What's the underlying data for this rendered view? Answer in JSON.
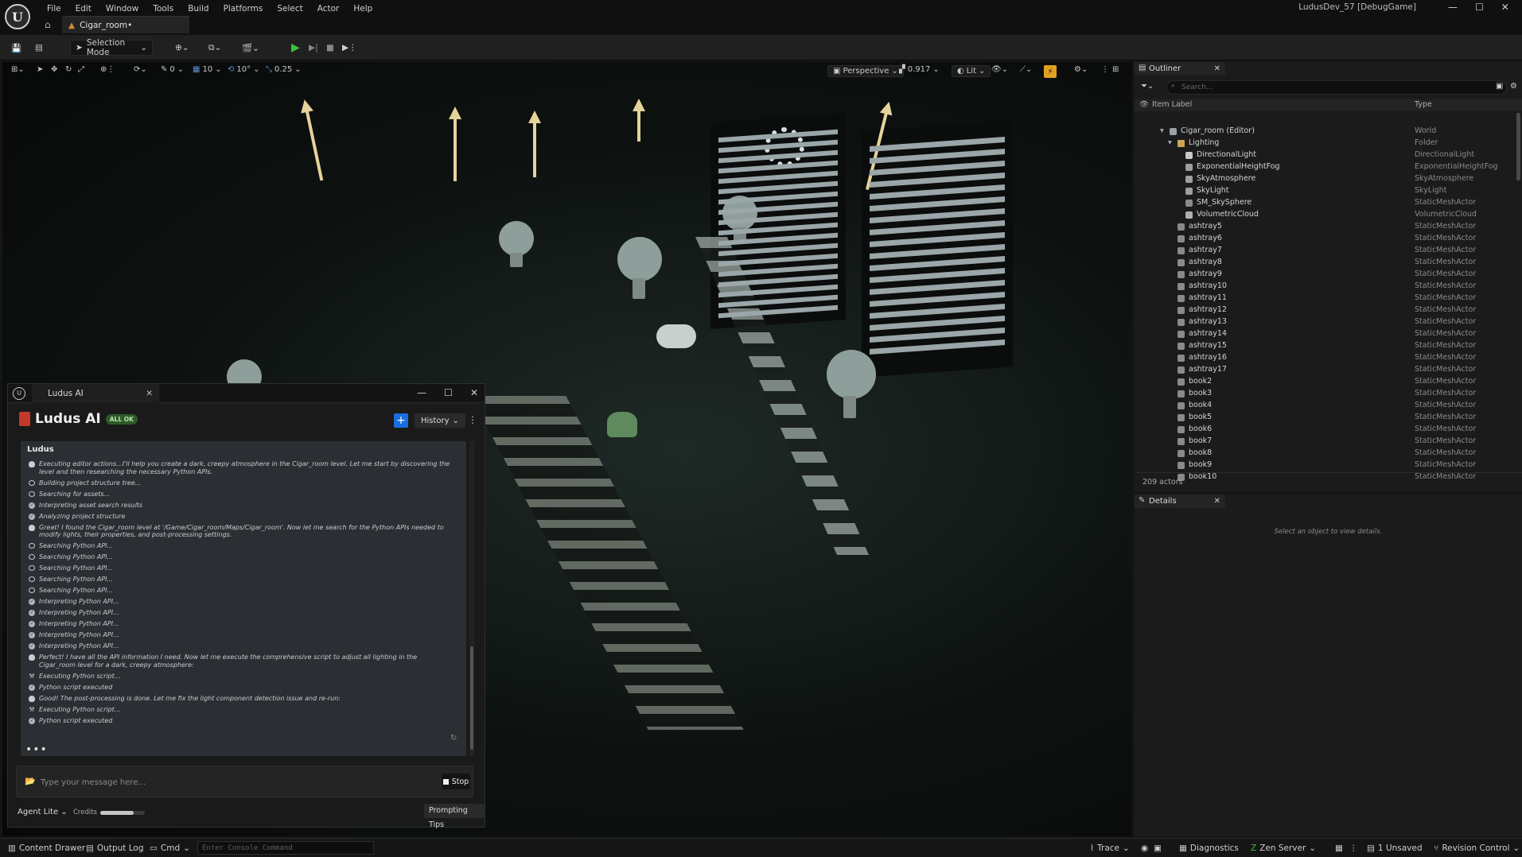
{
  "window": {
    "menu": [
      "File",
      "Edit",
      "Window",
      "Tools",
      "Build",
      "Platforms",
      "Select",
      "Actor",
      "Help"
    ],
    "doc_tab": "Cigar_room•",
    "build_label": "LudusDev_57 [DebugGame]"
  },
  "toolbar": {
    "mode_label": "Selection Mode"
  },
  "viewport": {
    "grid_snap": "10",
    "rotate_snap": "10°",
    "scale_snap": "0.25",
    "angle_value": "0",
    "view_mode": "Perspective",
    "fov": "0.917",
    "lit_mode": "Lit"
  },
  "ludus": {
    "window_title": "Ludus AI",
    "brand": "Ludus AI",
    "badge": "ALL OK",
    "history_label": "History",
    "chat_title": "Ludus",
    "messages": [
      {
        "icon": "bulb",
        "text": "Executing editor actions...I'll help you create a dark, creepy atmosphere in the Cigar_room level. Let me start by discovering the level and then researching the necessary Python APIs."
      },
      {
        "icon": "search",
        "text": "Building project structure tree..."
      },
      {
        "icon": "search",
        "text": "Searching for assets..."
      },
      {
        "icon": "check",
        "text": "Interpreting asset search results"
      },
      {
        "icon": "check",
        "text": "Analyzing project structure"
      },
      {
        "icon": "bulb",
        "text": "Great! I found the Cigar_room level at '/Game/Cigar_room/Maps/Cigar_room'. Now let me search for the Python APIs needed to modify lights, their properties, and post-processing settings."
      },
      {
        "icon": "search",
        "text": "Searching Python API..."
      },
      {
        "icon": "search",
        "text": "Searching Python API..."
      },
      {
        "icon": "search",
        "text": "Searching Python API..."
      },
      {
        "icon": "search",
        "text": "Searching Python API..."
      },
      {
        "icon": "search",
        "text": "Searching Python API..."
      },
      {
        "icon": "check",
        "text": "Interpreting Python API..."
      },
      {
        "icon": "check",
        "text": "Interpreting Python API..."
      },
      {
        "icon": "check",
        "text": "Interpreting Python API..."
      },
      {
        "icon": "check",
        "text": "Interpreting Python API..."
      },
      {
        "icon": "check",
        "text": "Interpreting Python API..."
      },
      {
        "icon": "bulb",
        "text": "Perfect! I have all the API information I need. Now let me execute the comprehensive script to adjust all lighting in the Cigar_room level for a dark, creepy atmosphere:"
      },
      {
        "icon": "tool",
        "text": "Executing Python script..."
      },
      {
        "icon": "check",
        "text": "Python script executed"
      },
      {
        "icon": "bulb",
        "text": "Good! The post-processing is done. Let me fix the light component detection issue and re-run:"
      },
      {
        "icon": "tool",
        "text": "Executing Python script..."
      },
      {
        "icon": "check",
        "text": "Python script executed"
      }
    ],
    "typing_indicator": "•••",
    "input_placeholder": "Type your message here...",
    "stop_label": "Stop",
    "agent_label": "Agent Lite",
    "credits_label": "Credits",
    "credits_fraction": 0.75,
    "tips_label": "Prompting Tips"
  },
  "outliner": {
    "tab_label": "Outliner",
    "search_placeholder": "Search...",
    "col_label": "Item Label",
    "col_type": "Type",
    "rows": [
      {
        "label": "Cigar_room (Editor)",
        "type": "World",
        "indent": 0,
        "icon": "world"
      },
      {
        "label": "Lighting",
        "type": "Folder",
        "indent": 1,
        "icon": "folder"
      },
      {
        "label": "DirectionalLight",
        "type": "DirectionalLight",
        "indent": 2,
        "icon": "light"
      },
      {
        "label": "ExponentialHeightFog",
        "type": "ExponentialHeightFog",
        "indent": 2,
        "icon": "fog"
      },
      {
        "label": "SkyAtmosphere",
        "type": "SkyAtmosphere",
        "indent": 2,
        "icon": "sky"
      },
      {
        "label": "SkyLight",
        "type": "SkyLight",
        "indent": 2,
        "icon": "sky"
      },
      {
        "label": "SM_SkySphere",
        "type": "StaticMeshActor",
        "indent": 2,
        "icon": "mesh"
      },
      {
        "label": "VolumetricCloud",
        "type": "VolumetricCloud",
        "indent": 2,
        "icon": "cloud"
      },
      {
        "label": "ashtray5",
        "type": "StaticMeshActor",
        "indent": 1,
        "icon": "mesh"
      },
      {
        "label": "ashtray6",
        "type": "StaticMeshActor",
        "indent": 1,
        "icon": "mesh"
      },
      {
        "label": "ashtray7",
        "type": "StaticMeshActor",
        "indent": 1,
        "icon": "mesh"
      },
      {
        "label": "ashtray8",
        "type": "StaticMeshActor",
        "indent": 1,
        "icon": "mesh"
      },
      {
        "label": "ashtray9",
        "type": "StaticMeshActor",
        "indent": 1,
        "icon": "mesh"
      },
      {
        "label": "ashtray10",
        "type": "StaticMeshActor",
        "indent": 1,
        "icon": "mesh"
      },
      {
        "label": "ashtray11",
        "type": "StaticMeshActor",
        "indent": 1,
        "icon": "mesh"
      },
      {
        "label": "ashtray12",
        "type": "StaticMeshActor",
        "indent": 1,
        "icon": "mesh"
      },
      {
        "label": "ashtray13",
        "type": "StaticMeshActor",
        "indent": 1,
        "icon": "mesh"
      },
      {
        "label": "ashtray14",
        "type": "StaticMeshActor",
        "indent": 1,
        "icon": "mesh"
      },
      {
        "label": "ashtray15",
        "type": "StaticMeshActor",
        "indent": 1,
        "icon": "mesh"
      },
      {
        "label": "ashtray16",
        "type": "StaticMeshActor",
        "indent": 1,
        "icon": "mesh"
      },
      {
        "label": "ashtray17",
        "type": "StaticMeshActor",
        "indent": 1,
        "icon": "mesh"
      },
      {
        "label": "book2",
        "type": "StaticMeshActor",
        "indent": 1,
        "icon": "mesh"
      },
      {
        "label": "book3",
        "type": "StaticMeshActor",
        "indent": 1,
        "icon": "mesh"
      },
      {
        "label": "book4",
        "type": "StaticMeshActor",
        "indent": 1,
        "icon": "mesh"
      },
      {
        "label": "book5",
        "type": "StaticMeshActor",
        "indent": 1,
        "icon": "mesh"
      },
      {
        "label": "book6",
        "type": "StaticMeshActor",
        "indent": 1,
        "icon": "mesh"
      },
      {
        "label": "book7",
        "type": "StaticMeshActor",
        "indent": 1,
        "icon": "mesh"
      },
      {
        "label": "book8",
        "type": "StaticMeshActor",
        "indent": 1,
        "icon": "mesh"
      },
      {
        "label": "book9",
        "type": "StaticMeshActor",
        "indent": 1,
        "icon": "mesh"
      },
      {
        "label": "book10",
        "type": "StaticMeshActor",
        "indent": 1,
        "icon": "mesh"
      }
    ],
    "actor_count": "209 actors"
  },
  "details": {
    "tab_label": "Details",
    "empty_text": "Select an object to view details."
  },
  "statusbar": {
    "content_drawer": "Content Drawer",
    "output_log": "Output Log",
    "cmd": "Cmd",
    "console_placeholder": "Enter Console Command",
    "trace": "Trace",
    "diagnostics": "Diagnostics",
    "zen_server": "Zen Server",
    "unsaved": "1 Unsaved",
    "revision_control": "Revision Control"
  }
}
